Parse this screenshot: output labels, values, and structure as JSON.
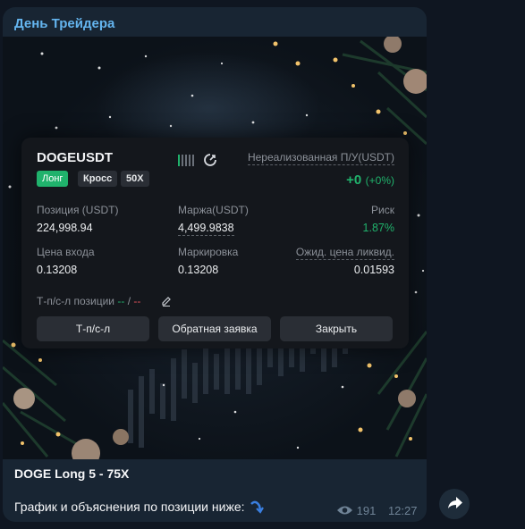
{
  "channel": {
    "name": "День Трейдера"
  },
  "position_card": {
    "symbol": "DOGEUSDT",
    "tags": {
      "direction": "Лонг",
      "margin_mode": "Кросс",
      "leverage": "50X"
    },
    "unrealized_label": "Нереализованная П/У(USDT)",
    "unrealized_value": "+0",
    "unrealized_percent": "(+0%)",
    "fields": {
      "position_label": "Позиция (USDT)",
      "position_value": "224,998.94",
      "margin_label": "Маржа(USDT)",
      "margin_value": "4,499.9838",
      "risk_label": "Риск",
      "risk_value": "1.87%",
      "entry_label": "Цена входа",
      "entry_value": "0.13208",
      "mark_label": "Маркировка",
      "mark_value": "0.13208",
      "liq_label": "Ожид. цена ликвид.",
      "liq_value": "0.01593"
    },
    "tpsl": {
      "label": "Т-п/с-л позиции",
      "tp": "--",
      "separator": "/",
      "sl": "--"
    },
    "buttons": {
      "tpsl": "Т-п/с-л",
      "reverse": "Обратная заявка",
      "close": "Закрыть"
    }
  },
  "caption": {
    "title": "DOGE Long 5 - 75X",
    "text": "График и объяснения по позиции ниже:"
  },
  "meta": {
    "views": "191",
    "time": "12:27"
  },
  "colors": {
    "accent": "#64b5ef",
    "green": "#20b26c",
    "bubble": "#182533",
    "background": "#0f1621"
  }
}
